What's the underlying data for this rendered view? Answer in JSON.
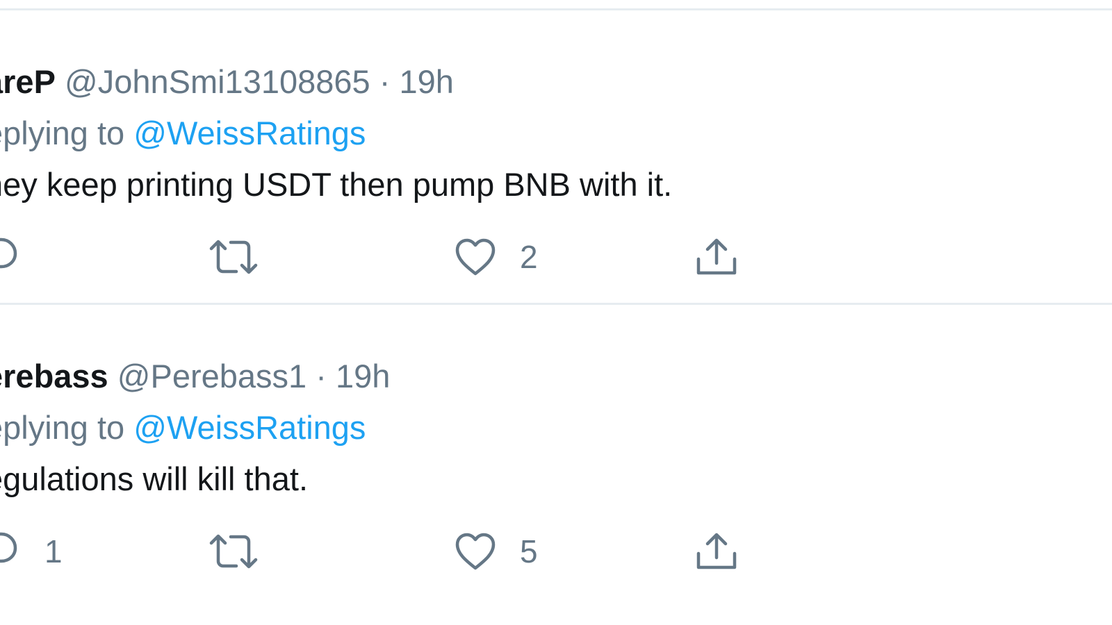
{
  "tweets": [
    {
      "display_name": "areP",
      "handle": "@JohnSmi13108865",
      "separator": "·",
      "time": "19h",
      "replying_prefix": "eplying to",
      "replying_to": "@WeissRatings",
      "text": "ney keep printing USDT then pump BNB with it.",
      "reply_count": "",
      "retweet_count": "",
      "like_count": "2"
    },
    {
      "display_name": "erebass",
      "handle": "@Perebass1",
      "separator": "·",
      "time": "19h",
      "replying_prefix": "eplying to",
      "replying_to": "@WeissRatings",
      "text": "egulations will kill that.",
      "reply_count": "1",
      "retweet_count": "",
      "like_count": "5"
    }
  ],
  "icons": {
    "reply": "reply-icon",
    "retweet": "retweet-icon",
    "like": "heart-icon",
    "share": "share-icon"
  },
  "colors": {
    "accent": "#1da1f2",
    "muted": "#657786",
    "text": "#14171a",
    "divider": "#e6ecf0"
  }
}
